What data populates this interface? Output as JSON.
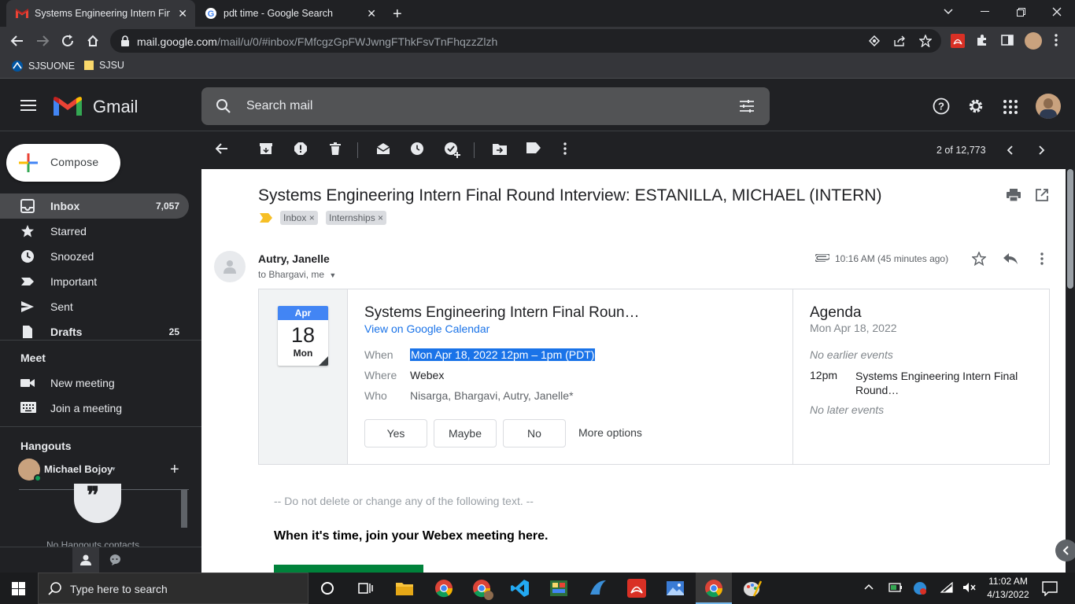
{
  "browser": {
    "tabs": [
      {
        "title": "Systems Engineering Intern Final",
        "active": true
      },
      {
        "title": "pdt time - Google Search",
        "active": false
      }
    ],
    "url_host": "mail.google.com",
    "url_path": "/mail/u/0/#inbox/FMfcgzGpFWJwngFThkFsvTnFhqzzZlzh",
    "bookmarks": [
      "SJSUONE",
      "SJSU"
    ]
  },
  "gmail": {
    "brand": "Gmail",
    "search_placeholder": "Search mail",
    "compose_label": "Compose",
    "nav": [
      {
        "label": "Inbox",
        "count": "7,057"
      },
      {
        "label": "Starred",
        "count": ""
      },
      {
        "label": "Snoozed",
        "count": ""
      },
      {
        "label": "Important",
        "count": ""
      },
      {
        "label": "Sent",
        "count": ""
      },
      {
        "label": "Drafts",
        "count": "25"
      }
    ],
    "meet": {
      "title": "Meet",
      "new_meeting": "New meeting",
      "join_meeting": "Join a meeting"
    },
    "hangouts": {
      "title": "Hangouts",
      "user": "Michael Bojoy",
      "no_contacts": "No Hangouts contacts"
    },
    "pager": "2 of 12,773"
  },
  "message": {
    "subject": "Systems Engineering Intern Final Round Interview: ESTANILLA, MICHAEL (INTERN)",
    "labels": [
      "Inbox",
      "Internships"
    ],
    "sender": "Autry, Janelle",
    "to": "to Bhargavi, me",
    "time": "10:16 AM (45 minutes ago)",
    "invite": {
      "month": "Apr",
      "day": "18",
      "weekday": "Mon",
      "title": "Systems Engineering Intern Final Roun…",
      "calendar_link": "View on Google Calendar",
      "when_label": "When",
      "when": "Mon Apr 18, 2022 12pm – 1pm (PDT)",
      "where_label": "Where",
      "where": "Webex",
      "who_label": "Who",
      "who": "Nisarga, Bhargavi, Autry, Janelle*",
      "rsvp_yes": "Yes",
      "rsvp_maybe": "Maybe",
      "rsvp_no": "No",
      "more_options": "More options"
    },
    "agenda": {
      "title": "Agenda",
      "date": "Mon Apr 18, 2022",
      "no_earlier": "No earlier events",
      "event_time": "12pm",
      "event_title": "Systems Engineering Intern Final Round…",
      "no_later": "No later events"
    },
    "body_note": "-- Do not delete or change any of the following text. --",
    "join_text": "When it's time, join your Webex meeting here."
  },
  "taskbar": {
    "search_placeholder": "Type here to search",
    "time": "11:02 AM",
    "date": "4/13/2022"
  },
  "colors": {
    "accent": "#1a73e8",
    "chrome_dark": "#202124",
    "tab_active": "#35363a",
    "webex_green": "#00823b"
  }
}
